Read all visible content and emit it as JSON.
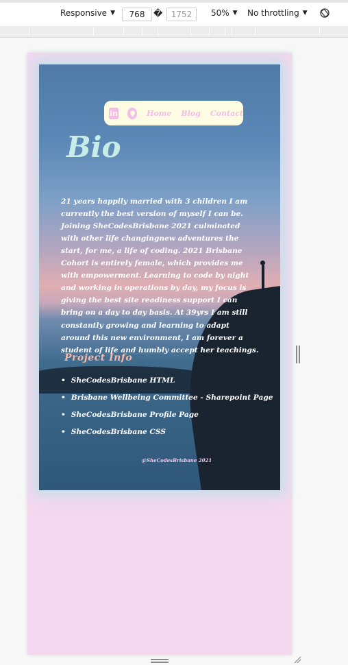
{
  "toolbar": {
    "device_mode": "Responsive",
    "width": "768",
    "height": "1752",
    "swap_glyph": "�",
    "zoom": "50%",
    "throttling": "No throttling"
  },
  "page": {
    "nav": {
      "icons": [
        "linkedin-icon",
        "github-icon"
      ],
      "linkedin_glyph": "in",
      "links": [
        "Home",
        "Blog",
        "Contact"
      ]
    },
    "bio": {
      "title": "Bio",
      "text": "21 years happily married with 3 children I am currently the best version of myself I can be. Joining SheCodesBrisbane 2021 culminated with other life changingnew adventures the start, for me, a life of coding. 2021 Brisbane Cohort is entirely female, which provides me with empowerment. Learning to code by night and working in operations by day, my focus is giving the best site readiness support I can bring on a day to day basis. At 39yrs I am still constantly growing and learning to adapt around this new environment, I am forever a student of life and humbly accept her teachings."
    },
    "project": {
      "title": "Project Info",
      "items": [
        "SheCodesBrisbane HTML",
        "Brisbane Wellbeing Committee - Sharepoint Page",
        "SheCodesBrisbane Profile Page",
        "SheCodesBrisbane CSS"
      ]
    },
    "footer": "@SheCodesBrisbane 2021"
  },
  "colors": {
    "viewport_bg": "#f4d8ef",
    "nav_bg": "#fffce4",
    "nav_accent": "#f3bde8",
    "bio_title": "#c8ede8",
    "project_title": "#f6b9a5",
    "card_glow": "#a0e6e1"
  }
}
